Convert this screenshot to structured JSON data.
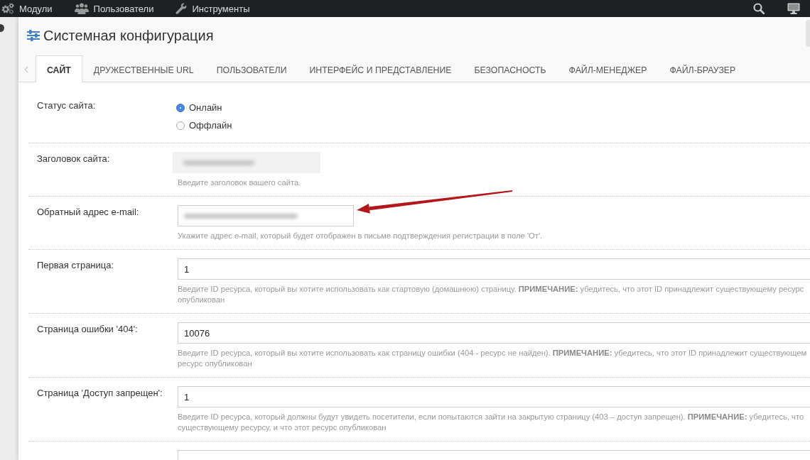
{
  "top_bar": {
    "menu": [
      {
        "label": "Модули"
      },
      {
        "label": "Пользователи"
      },
      {
        "label": "Инструменты"
      }
    ]
  },
  "page": {
    "title": "Системная конфигурация"
  },
  "tabs": [
    {
      "label": "САЙТ",
      "selected": true
    },
    {
      "label": "ДРУЖЕСТВЕННЫЕ URL",
      "selected": false
    },
    {
      "label": "ПОЛЬЗОВАТЕЛИ",
      "selected": false
    },
    {
      "label": "ИНТЕРФЕЙС И ПРЕДСТАВЛЕНИЕ",
      "selected": false
    },
    {
      "label": "БЕЗОПАСНОСТЬ",
      "selected": false
    },
    {
      "label": "ФАЙЛ-МЕНЕДЖЕР",
      "selected": false
    },
    {
      "label": "ФАЙЛ-БРАУЗЕР",
      "selected": false
    }
  ],
  "settings": [
    {
      "kind": "radio",
      "label": "Статус сайта:",
      "options": [
        {
          "label": "Онлайн",
          "selected": true
        },
        {
          "label": "Оффлайн",
          "selected": false
        }
      ]
    },
    {
      "kind": "short",
      "label": "Заголовок сайта:",
      "redacted": true,
      "help": [
        "Введите заголовок вашего сайта."
      ]
    },
    {
      "kind": "medium",
      "label": "Обратный адрес e-mail:",
      "redacted": true,
      "help": [
        "Укажите адрес e-mail, который будет отображен в письме подтверждения регистрации в поле 'От'."
      ]
    },
    {
      "kind": "wide",
      "label": "Первая страница:",
      "value": "1",
      "help": [
        "Введите ID ресурса, который вы хотите использовать как стартовую (домашнюю) страницу. **ПРИМЕЧАНИЕ:** убедитесь, что этот ID принадлежит существующему ресурс",
        "опубликован"
      ]
    },
    {
      "kind": "wide",
      "label": "Страница ошибки '404':",
      "value": "10076",
      "help": [
        "Введите ID ресурса, который вы хотите использовать как страницу ошибки (404 - ресурс не найден). **ПРИМЕЧАНИЕ:** убедитесь, что этот ID принадлежит существующем",
        "ресурс опубликован"
      ]
    },
    {
      "kind": "wide",
      "label": "Страница 'Доступ запрещен':",
      "value": "1",
      "help": [
        "Введите ID ресурса, который должны будут увидеть посетители, если попытаются зайти на закрытую страницу (403 – доступ запрещен). **ПРИМЕЧАНИЕ:** убедитесь, что",
        "существующему ресурсу, и что этот ресурс опубликован"
      ]
    },
    {
      "kind": "wide"
    }
  ]
}
